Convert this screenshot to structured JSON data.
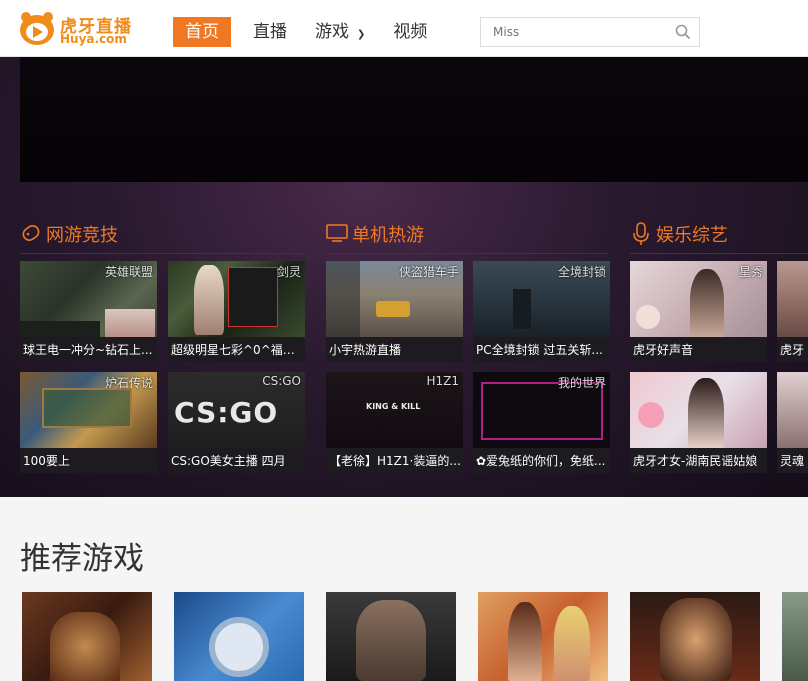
{
  "brand": {
    "name": "虎牙直播",
    "domain": "Huya.com",
    "accent": "#f07822"
  },
  "nav": {
    "items": [
      {
        "label": "首页",
        "active": true
      },
      {
        "label": "直播",
        "active": false
      },
      {
        "label": "游戏",
        "active": false,
        "dropdown": true
      },
      {
        "label": "视频",
        "active": false
      }
    ]
  },
  "search": {
    "placeholder": "Miss",
    "icon": "search-icon"
  },
  "sections": [
    {
      "title": "网游竞技",
      "icon": "gamepad-icon",
      "cards": [
        {
          "tag": "英雄联盟",
          "title": "球王电一冲分~钻石上..."
        },
        {
          "tag": "剑灵",
          "title": "超级明星七彩^0^福利..."
        },
        {
          "tag": "炉石传说",
          "title": "100要上"
        },
        {
          "tag": "CS:GO",
          "title": "CS:GO美女主播 四月"
        }
      ]
    },
    {
      "title": "单机热游",
      "icon": "monitor-icon",
      "cards": [
        {
          "tag": "侠盗猎车手",
          "title": "小宇热游直播"
        },
        {
          "tag": "全境封锁",
          "title": "PC全境封锁 过五关斩..."
        },
        {
          "tag": "H1Z1",
          "title": "【老徐】H1Z1·装逼的..."
        },
        {
          "tag": "我的世界",
          "title": "✿爱兔纸的你们，免纸..."
        }
      ]
    },
    {
      "title": "娱乐综艺",
      "icon": "microphone-icon",
      "cards": [
        {
          "tag": "星秀",
          "title": "虎牙好声音"
        },
        {
          "tag": "",
          "title": "虎牙"
        },
        {
          "tag": "",
          "title": "虎牙才女-湖南民谣姑娘"
        },
        {
          "tag": "",
          "title": "灵魂"
        }
      ]
    }
  ],
  "thumb_texts": {
    "csgo_logo": "CS:GO",
    "h1z1_banner": "KING & KILL"
  },
  "recommended": {
    "title": "推荐游戏"
  }
}
